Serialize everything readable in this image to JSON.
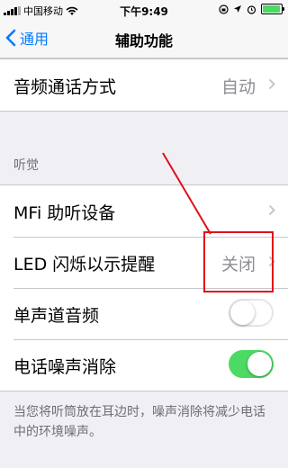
{
  "status_bar": {
    "carrier": "中国移动",
    "time": "下午9:49",
    "icons": [
      "signal-icon",
      "wifi-icon",
      "orientation-lock-icon",
      "location-icon",
      "alarm-icon",
      "battery-icon"
    ]
  },
  "nav": {
    "back_label": "通用",
    "title": "辅助功能"
  },
  "group1": {
    "rows": [
      {
        "label": "音频通话方式",
        "value": "自动"
      }
    ]
  },
  "hearing": {
    "header": "听觉",
    "rows": [
      {
        "label": "MFi 助听设备",
        "value": ""
      },
      {
        "label": "LED 闪烁以示提醒",
        "value": "关闭"
      },
      {
        "label": "单声道音频",
        "toggle": false
      },
      {
        "label": "电话噪声消除",
        "toggle": true
      }
    ],
    "footer": "当您将听筒放在耳边时，噪声消除将减少电话中的环境噪声。"
  },
  "colors": {
    "accent": "#007aff",
    "toggle_on": "#4cd964",
    "annotation": "#e0101a"
  }
}
